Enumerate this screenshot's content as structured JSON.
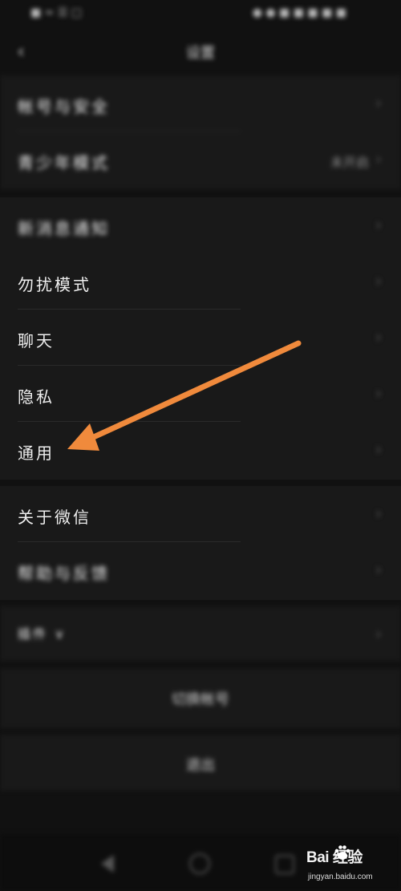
{
  "status": {
    "left": "■ ≈ ☰ □",
    "right": "● ● ■ ■ ■ ■ ■"
  },
  "header": {
    "title": "设置"
  },
  "group1": {
    "items": [
      {
        "label": "帐号与安全",
        "value": ""
      },
      {
        "label": "青少年模式",
        "value": "未开启"
      }
    ]
  },
  "group2": {
    "items": [
      {
        "label": "新消息通知"
      },
      {
        "label": "勿扰模式"
      },
      {
        "label": "聊天"
      },
      {
        "label": "隐私"
      },
      {
        "label": "通用"
      }
    ]
  },
  "group3": {
    "items": [
      {
        "label": "关于微信"
      },
      {
        "label": "帮助与反馈"
      }
    ]
  },
  "group4": {
    "label": "插件 ∨"
  },
  "switch_account": "切换帐号",
  "logout": "退出",
  "watermark": {
    "main": "Bai  经验",
    "sub": "jingyan.baidu.com"
  },
  "colors": {
    "background": "#111111",
    "row_background": "#191919",
    "arrow": "#f08a3c"
  },
  "icons": {
    "back": "back-arrow-icon",
    "chevron": "chevron-right-icon"
  }
}
